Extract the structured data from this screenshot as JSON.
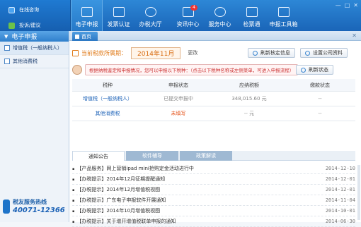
{
  "sidebar_top": {
    "online_consult": "在线咨询",
    "complaint": "投诉/建议"
  },
  "nav": [
    {
      "label": "电子申报",
      "icon": "declaration-icon"
    },
    {
      "label": "发票认证",
      "icon": "invoice-icon"
    },
    {
      "label": "办税大厅",
      "icon": "hall-icon"
    },
    {
      "label": "资讯中心",
      "icon": "news-icon",
      "badge": "4"
    },
    {
      "label": "服务中心",
      "icon": "service-icon"
    },
    {
      "label": "检票通",
      "icon": "ticket-icon"
    },
    {
      "label": "申报工具箱",
      "icon": "toolbox-icon"
    }
  ],
  "sidebar": {
    "title": "电子申报",
    "items": [
      {
        "label": "增值税（一般纳税人）"
      },
      {
        "label": "其他消费税"
      }
    ]
  },
  "hotline": {
    "title": "税友服务热线",
    "number": "40071-12366"
  },
  "tab": {
    "label": "首页"
  },
  "period": {
    "label": "当前税款所属期：",
    "value": "2014年11月",
    "change": "更改"
  },
  "buttons": {
    "refresh": "刷新核定信息",
    "settings": "设置公司资料",
    "status": "刷新状态"
  },
  "notice": "根据纳税鉴定和申报情况，您可以申报以下税种：（点击以下税种名称或左侧菜单，可进入申报流程）",
  "table": {
    "headers": [
      "税种",
      "申报状态",
      "应纳税额",
      "缴款状态"
    ],
    "rows": [
      [
        "增值税（一般纳税人）",
        "已提交申报中",
        "348,015.60 元",
        "--"
      ],
      [
        "其他消费税",
        "未填写",
        "-- 元",
        "--"
      ]
    ]
  },
  "bottom_tabs": [
    "通知公告",
    "软件辅导",
    "政策解读"
  ],
  "news": [
    {
      "title": "【产品服务】网上营销ipad mini抢购定金活动进行中",
      "date": "2014-12-10"
    },
    {
      "title": "【办税提示】2014年12月征期提醒通知",
      "date": "2014-12-01"
    },
    {
      "title": "【办税提示】2014年12月增值税视图",
      "date": "2014-12-01"
    },
    {
      "title": "【办税提示】广东电子申报软件开展通知",
      "date": "2014-11-04"
    },
    {
      "title": "【办税提示】2014年10月增值税视图",
      "date": "2014-10-01"
    },
    {
      "title": "【办税提示】关于增开增值税联单申报的通知",
      "date": "2014-06-30"
    }
  ]
}
